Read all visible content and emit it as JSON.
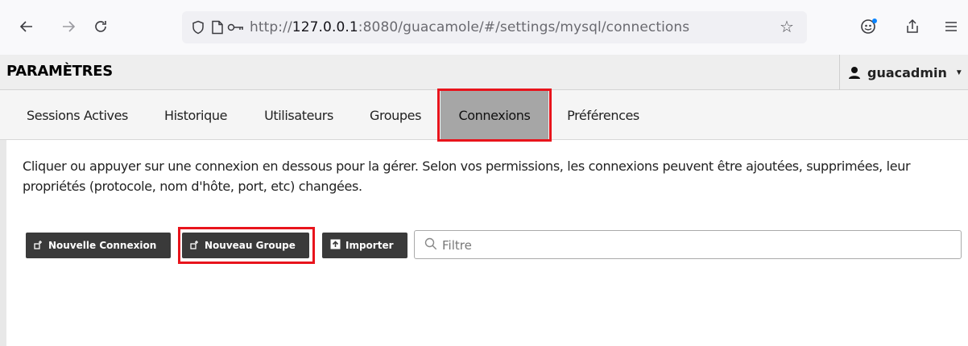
{
  "browser": {
    "url_prefix": "http://",
    "url_host": "127.0.0.1",
    "url_rest": ":8080/guacamole/#/settings/mysql/connections"
  },
  "header": {
    "title": "PARAMÈTRES",
    "username": "guacadmin"
  },
  "tabs": [
    {
      "label": "Sessions Actives",
      "active": false
    },
    {
      "label": "Historique",
      "active": false
    },
    {
      "label": "Utilisateurs",
      "active": false
    },
    {
      "label": "Groupes",
      "active": false
    },
    {
      "label": "Connexions",
      "active": true
    },
    {
      "label": "Préférences",
      "active": false
    }
  ],
  "main": {
    "description": "Cliquer ou appuyer sur une connexion en dessous pour la gérer. Selon vos permissions, les connexions peuvent être ajoutées, supprimées, leur propriétés (protocole, nom d'hôte, port, etc) changées.",
    "buttons": {
      "new_connection": "Nouvelle Connexion",
      "new_group": "Nouveau Groupe",
      "import": "Importer"
    },
    "filter_placeholder": "Filtre"
  },
  "colors": {
    "highlight": "#e8141c",
    "active_tab": "#a6a6a6",
    "button_bg": "#3a3a3a"
  }
}
